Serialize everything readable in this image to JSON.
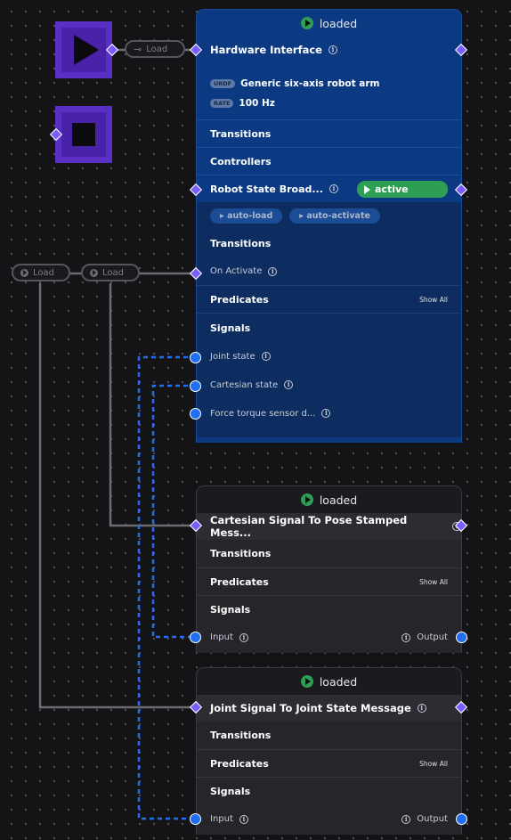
{
  "palette": {
    "play_button": "#5a2fc4",
    "accent_blue": "#1f6ff0",
    "active_green": "#2e9e55",
    "port_purple": "#7b5cff"
  },
  "controls": {
    "play_icon": "play-icon",
    "stop_icon": "stop-icon"
  },
  "pills": {
    "plug_load": "Load",
    "load_1": "Load",
    "load_2": "Load"
  },
  "hardware": {
    "status": "loaded",
    "title": "Hardware Interface",
    "urdf_tag": "URDF",
    "urdf_value": "Generic six-axis robot arm",
    "rate_tag": "RATE",
    "rate_value": "100 Hz",
    "transitions": "Transitions",
    "controllers": "Controllers",
    "controller": {
      "name": "Robot State Broad...",
      "state": "active",
      "auto_load": "auto-load",
      "auto_activate": "auto-activate",
      "transitions": "Transitions",
      "on_activate": "On Activate",
      "predicates": "Predicates",
      "show_all": "Show All",
      "signals": "Signals",
      "signal_items": [
        "Joint state",
        "Cartesian state",
        "Force torque sensor d..."
      ]
    }
  },
  "cartesian_node": {
    "status": "loaded",
    "title": "Cartesian Signal To Pose Stamped Mess...",
    "transitions": "Transitions",
    "predicates": "Predicates",
    "show_all": "Show All",
    "signals": "Signals",
    "input": "Input",
    "output": "Output"
  },
  "joint_node": {
    "status": "loaded",
    "title": "Joint Signal To Joint State Message",
    "transitions": "Transitions",
    "predicates": "Predicates",
    "show_all": "Show All",
    "signals": "Signals",
    "input": "Input",
    "output": "Output"
  }
}
